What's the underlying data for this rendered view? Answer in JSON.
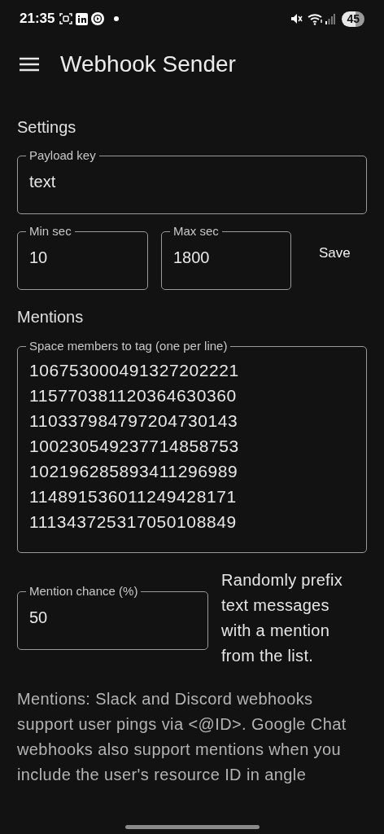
{
  "status_bar": {
    "time": "21:35",
    "battery": "45"
  },
  "app_bar": {
    "title": "Webhook Sender"
  },
  "settings": {
    "heading": "Settings",
    "payload_key": {
      "label": "Payload key",
      "value": "text"
    },
    "min_sec": {
      "label": "Min sec",
      "value": "10"
    },
    "max_sec": {
      "label": "Max sec",
      "value": "1800"
    },
    "save_button": "Save"
  },
  "mentions": {
    "heading": "Mentions",
    "members": {
      "label": "Space members to tag (one per line)",
      "lines": [
        "106753000491327202221",
        "115770381120364630360",
        "110337984797204730143",
        "100230549237714858753",
        "102196285893411296989",
        "114891536011249428171",
        "111343725317050108849"
      ]
    },
    "chance": {
      "label": "Mention chance (%)",
      "value": "50"
    },
    "chance_hint": "Randomly prefix text messages with a mention from the list.",
    "note": "Mentions: Slack and Discord webhooks support user pings via <@ID>. Google Chat webhooks also support mentions when you include the user's resource ID in angle"
  }
}
